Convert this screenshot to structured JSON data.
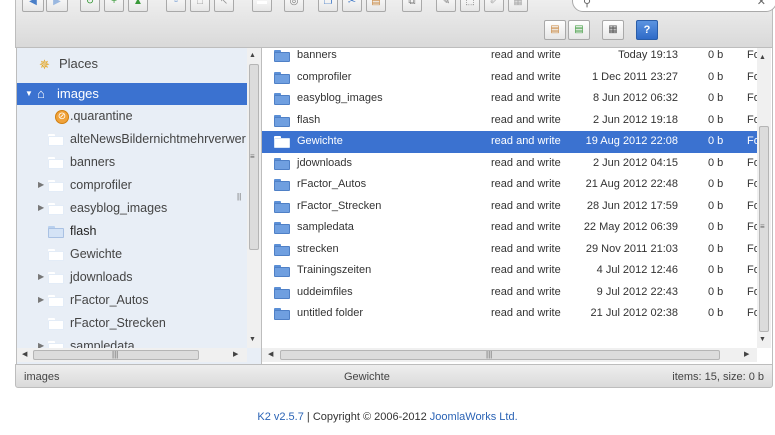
{
  "tree": {
    "places_label": "Places",
    "items": [
      {
        "label": "images",
        "expanded": true,
        "selected": true
      },
      {
        "label": ".quarantine"
      },
      {
        "label": "alteNewsBildernichtmehrverwer"
      },
      {
        "label": "banners"
      },
      {
        "label": "comprofiler",
        "has_children": true
      },
      {
        "label": "easyblog_images",
        "has_children": true
      },
      {
        "label": "flash"
      },
      {
        "label": "Gewichte"
      },
      {
        "label": "jdownloads",
        "has_children": true
      },
      {
        "label": "rFactor_Autos",
        "has_children": true
      },
      {
        "label": "rFactor_Strecken"
      },
      {
        "label": "sampledata",
        "has_children": true
      }
    ]
  },
  "files": {
    "rows": [
      {
        "name": "banners",
        "perm": "read and write",
        "date": "Today 19:13",
        "size": "0 b",
        "kind": "Fo"
      },
      {
        "name": "comprofiler",
        "perm": "read and write",
        "date": "1 Dec 2011 23:27",
        "size": "0 b",
        "kind": "Fo"
      },
      {
        "name": "easyblog_images",
        "perm": "read and write",
        "date": "8 Jun 2012 06:32",
        "size": "0 b",
        "kind": "Fo"
      },
      {
        "name": "flash",
        "perm": "read and write",
        "date": "2 Jun 2012 19:18",
        "size": "0 b",
        "kind": "Fo"
      },
      {
        "name": "Gewichte",
        "perm": "read and write",
        "date": "19 Aug 2012 22:08",
        "size": "0 b",
        "kind": "Fo",
        "selected": true
      },
      {
        "name": "jdownloads",
        "perm": "read and write",
        "date": "2 Jun 2012 04:15",
        "size": "0 b",
        "kind": "Fo"
      },
      {
        "name": "rFactor_Autos",
        "perm": "read and write",
        "date": "21 Aug 2012 22:48",
        "size": "0 b",
        "kind": "Fo"
      },
      {
        "name": "rFactor_Strecken",
        "perm": "read and write",
        "date": "28 Jun 2012 17:59",
        "size": "0 b",
        "kind": "Fo"
      },
      {
        "name": "sampledata",
        "perm": "read and write",
        "date": "22 May 2012 06:39",
        "size": "0 b",
        "kind": "Fo"
      },
      {
        "name": "strecken",
        "perm": "read and write",
        "date": "29 Nov 2011 21:03",
        "size": "0 b",
        "kind": "Fo"
      },
      {
        "name": "Trainingszeiten",
        "perm": "read and write",
        "date": "4 Jul 2012 12:46",
        "size": "0 b",
        "kind": "Fo"
      },
      {
        "name": "uddeimfiles",
        "perm": "read and write",
        "date": "9 Jul 2012 22:43",
        "size": "0 b",
        "kind": "Fo"
      },
      {
        "name": "untitled folder",
        "perm": "read and write",
        "date": "21 Jul 2012 02:38",
        "size": "0 b",
        "kind": "Fo"
      }
    ]
  },
  "status": {
    "path": "images",
    "selected": "Gewichte",
    "summary": "items: 15, size: 0 b"
  },
  "footer": {
    "version": "K2 v2.5.7",
    "separator": " | Copyright © 2006-2012 ",
    "company": "JoomlaWorks Ltd."
  },
  "colors": {
    "selection": "#3b72d0",
    "tree_background": "#e8eef6",
    "link": "#2a63b5"
  }
}
